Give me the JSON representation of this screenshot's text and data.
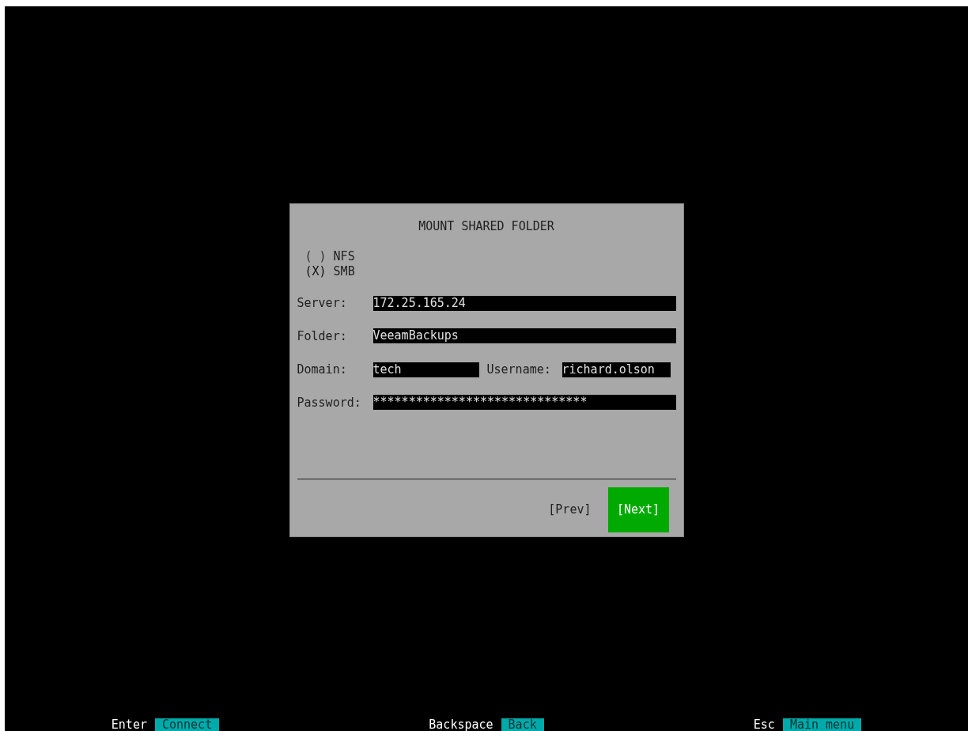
{
  "dialog": {
    "title": "MOUNT SHARED FOLDER",
    "radio_marks": {
      "selected": "(X)",
      "unselected": "( )"
    },
    "protocols": [
      {
        "label": "NFS",
        "selected": false
      },
      {
        "label": "SMB",
        "selected": true
      }
    ],
    "server": {
      "label": "Server:",
      "value": "172.25.165.24"
    },
    "folder": {
      "label": "Folder:",
      "value": "VeeamBackups"
    },
    "domain": {
      "label": "Domain:",
      "value": "tech"
    },
    "username": {
      "label": "Username:",
      "value": "richard.olson"
    },
    "password": {
      "label": "Password:",
      "value": "******************************"
    },
    "buttons": [
      {
        "label": "[Prev]",
        "selected": false
      },
      {
        "label": "[Next]",
        "selected": true
      }
    ]
  },
  "footer": [
    {
      "key": "Enter",
      "action": "Connect"
    },
    {
      "key": "Backspace",
      "action": "Back"
    },
    {
      "key": "Esc",
      "action": "Main menu"
    }
  ]
}
